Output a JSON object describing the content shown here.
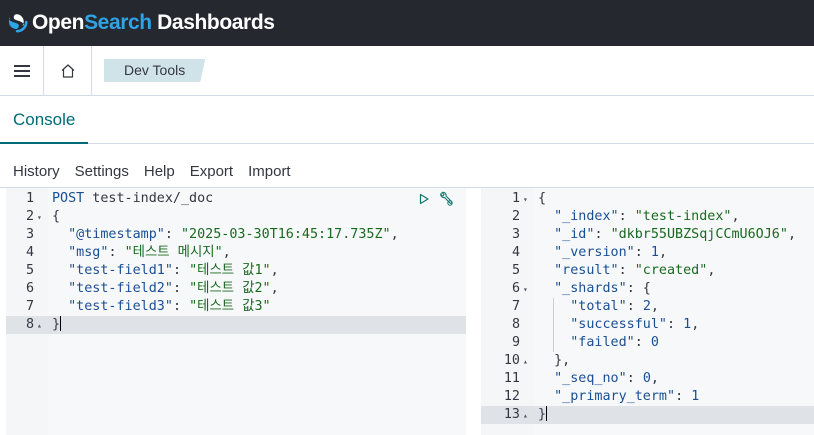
{
  "header": {
    "brand_part1": "Open",
    "brand_part2": "Search",
    "brand_part3": " Dashboards"
  },
  "nav": {
    "breadcrumb": "Dev Tools"
  },
  "tabs": {
    "console": "Console"
  },
  "menu": [
    "History",
    "Settings",
    "Help",
    "Export",
    "Import"
  ],
  "request": {
    "method": "POST",
    "path": "test-index/_doc",
    "line_numbers": [
      "1",
      "2",
      "3",
      "4",
      "5",
      "6",
      "7",
      "8"
    ],
    "lines": [
      [
        [
          "k",
          "POST"
        ],
        [
          "p",
          " test-index/_doc"
        ]
      ],
      [
        [
          "p",
          "{"
        ]
      ],
      [
        [
          "p",
          "  "
        ],
        [
          "u",
          "\"@timestamp\""
        ],
        [
          "p",
          ": "
        ],
        [
          "s",
          "\"2025-03-30T16:45:17.735Z\""
        ],
        [
          "p",
          ","
        ]
      ],
      [
        [
          "p",
          "  "
        ],
        [
          "u",
          "\"msg\""
        ],
        [
          "p",
          ": "
        ],
        [
          "s",
          "\"테스트 메시지\""
        ],
        [
          "p",
          ","
        ]
      ],
      [
        [
          "p",
          "  "
        ],
        [
          "u",
          "\"test-field1\""
        ],
        [
          "p",
          ": "
        ],
        [
          "s",
          "\"테스트 값1\""
        ],
        [
          "p",
          ","
        ]
      ],
      [
        [
          "p",
          "  "
        ],
        [
          "u",
          "\"test-field2\""
        ],
        [
          "p",
          ": "
        ],
        [
          "s",
          "\"테스트 값2\""
        ],
        [
          "p",
          ","
        ]
      ],
      [
        [
          "p",
          "  "
        ],
        [
          "u",
          "\"test-field3\""
        ],
        [
          "p",
          ": "
        ],
        [
          "s",
          "\"테스트 값3\""
        ]
      ],
      [
        [
          "p",
          "}"
        ]
      ]
    ]
  },
  "response": {
    "line_numbers": [
      "1",
      "2",
      "3",
      "4",
      "5",
      "6",
      "7",
      "8",
      "9",
      "10",
      "11",
      "12",
      "13"
    ],
    "lines": [
      [
        [
          "p",
          "{"
        ]
      ],
      [
        [
          "p",
          "  "
        ],
        [
          "u",
          "\"_index\""
        ],
        [
          "p",
          ": "
        ],
        [
          "s",
          "\"test-index\""
        ],
        [
          "p",
          ","
        ]
      ],
      [
        [
          "p",
          "  "
        ],
        [
          "u",
          "\"_id\""
        ],
        [
          "p",
          ": "
        ],
        [
          "s",
          "\"dkbr55UBZSqjCCmU6OJ6\""
        ],
        [
          "p",
          ","
        ]
      ],
      [
        [
          "p",
          "  "
        ],
        [
          "u",
          "\"_version\""
        ],
        [
          "p",
          ": "
        ],
        [
          "n",
          "1"
        ],
        [
          "p",
          ","
        ]
      ],
      [
        [
          "p",
          "  "
        ],
        [
          "u",
          "\"result\""
        ],
        [
          "p",
          ": "
        ],
        [
          "s",
          "\"created\""
        ],
        [
          "p",
          ","
        ]
      ],
      [
        [
          "p",
          "  "
        ],
        [
          "u",
          "\"_shards\""
        ],
        [
          "p",
          ": {"
        ]
      ],
      [
        [
          "p",
          "    "
        ],
        [
          "u",
          "\"total\""
        ],
        [
          "p",
          ": "
        ],
        [
          "n",
          "2"
        ],
        [
          "p",
          ","
        ]
      ],
      [
        [
          "p",
          "    "
        ],
        [
          "u",
          "\"successful\""
        ],
        [
          "p",
          ": "
        ],
        [
          "n",
          "1"
        ],
        [
          "p",
          ","
        ]
      ],
      [
        [
          "p",
          "    "
        ],
        [
          "u",
          "\"failed\""
        ],
        [
          "p",
          ": "
        ],
        [
          "n",
          "0"
        ]
      ],
      [
        [
          "p",
          "  },"
        ]
      ],
      [
        [
          "p",
          "  "
        ],
        [
          "u",
          "\"_seq_no\""
        ],
        [
          "p",
          ": "
        ],
        [
          "n",
          "0"
        ],
        [
          "p",
          ","
        ]
      ],
      [
        [
          "p",
          "  "
        ],
        [
          "u",
          "\"_primary_term\""
        ],
        [
          "p",
          ": "
        ],
        [
          "n",
          "1"
        ]
      ],
      [
        [
          "p",
          "}"
        ]
      ]
    ]
  },
  "icons": {
    "run": "play-icon",
    "settings": "wrench-icon",
    "menu": "hamburger-icon",
    "home": "home-icon"
  }
}
